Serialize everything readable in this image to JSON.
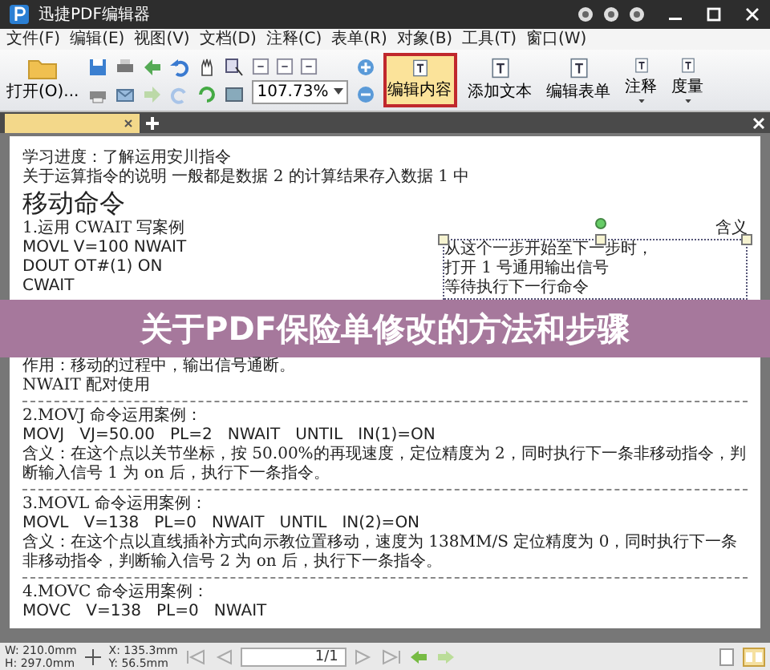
{
  "window": {
    "title": "迅捷PDF编辑器"
  },
  "menu": [
    "文件(F)",
    "编辑(E)",
    "视图(V)",
    "文档(D)",
    "注释(C)",
    "表单(R)",
    "对象(B)",
    "工具(T)",
    "窗口(W)"
  ],
  "toolbar": {
    "open_label": "打开(O)...",
    "zoom": "107.73%",
    "buttons": [
      {
        "label": "编辑内容",
        "selected": true,
        "dropdown": false
      },
      {
        "label": "添加文本",
        "selected": false,
        "dropdown": false
      },
      {
        "label": "编辑表单",
        "selected": false,
        "dropdown": false
      },
      {
        "label": "注释",
        "selected": false,
        "dropdown": true
      },
      {
        "label": "度量",
        "selected": false,
        "dropdown": true
      }
    ]
  },
  "document": {
    "intro": [
      "学习进度：了解运用安川指令",
      "关于运算指令的说明 一般都是数据 2 的计算结果存入数据 1 中"
    ],
    "heading": "移动命令",
    "example_title": "1.运用 CWAIT 写案例",
    "meaning_label": "含义",
    "code_lines": [
      "MOVL V=100 NWAIT",
      "DOUT OT#(1) ON",
      "CWAIT"
    ],
    "selected_lines": [
      "从这个一步开始至下一步时，",
      "打开 1 号通用输出信号",
      "等待执行下一行命令"
    ],
    "notes": [
      "作用：移动的过程中，输出信号通断。",
      "NWAIT 配对使用"
    ],
    "sections": [
      {
        "title": "2.MOVJ 命令运用案例：",
        "code": "MOVJ   VJ=50.00   PL=2   NWAIT   UNTIL   IN(1)=ON",
        "meaning": "含义：在这个点以关节坐标，按 50.00%的再现速度，定位精度为 2，同时执行下一条非移动指令，判断输入信号 1 为 on 后，执行下一条指令。"
      },
      {
        "title": "3.MOVL 命令运用案例：",
        "code": "MOVL   V=138   PL=0   NWAIT   UNTIL   IN(2)=ON",
        "meaning": "含义：在这个点以直线插补方式向示教位置移动，速度为 138MM/S 定位精度为 0，同时执行下一条非移动指令，判断输入信号 2 为 on 后，执行下一条指令。"
      },
      {
        "title": "4.MOVC 命令运用案例：",
        "code": "MOVC   V=138   PL=0   NWAIT"
      }
    ]
  },
  "banner": "关于PDF保险单修改的方法和步骤",
  "status_bar": {
    "width": "W: 210.0mm",
    "height": "H: 297.0mm",
    "x": "X: 135.3mm",
    "y": "Y: 56.5mm",
    "page": "1/1"
  }
}
